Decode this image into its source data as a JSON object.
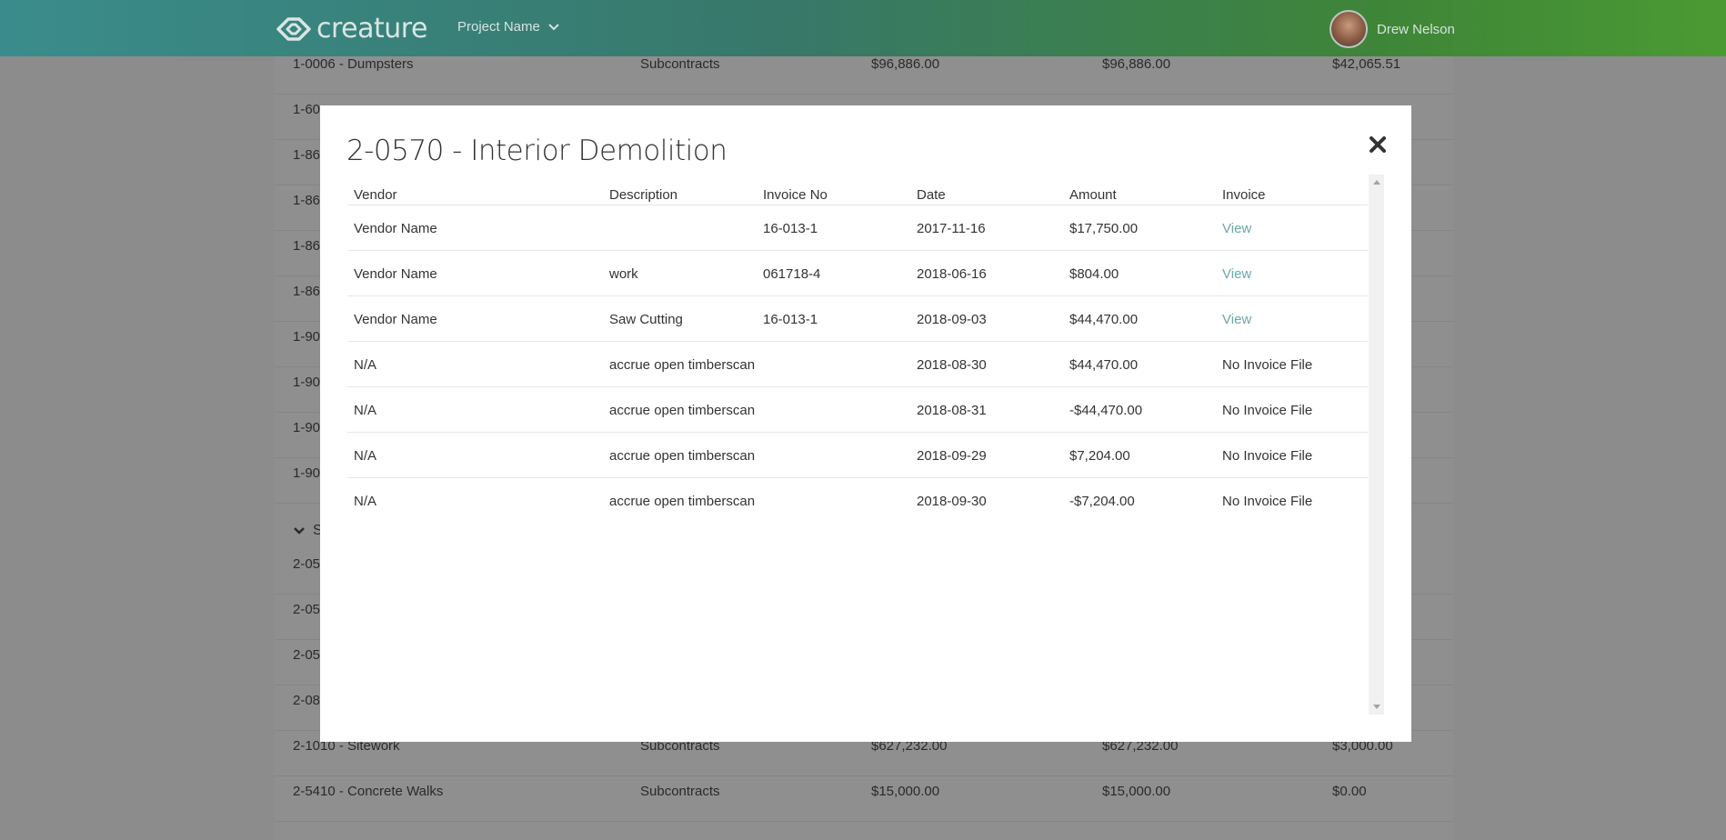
{
  "navbar": {
    "logo_text": "creature",
    "project_label": "Project Name",
    "user_name": "Drew Nelson"
  },
  "background_table": {
    "rows_top": [
      {
        "name": "1-0006 - Dumpsters",
        "type": "Subcontracts",
        "budget": "$96,886.00",
        "revised": "$96,886.00",
        "spent": "$42,065.51"
      },
      {
        "name": "1-60"
      },
      {
        "name": "1-86"
      },
      {
        "name": "1-86"
      },
      {
        "name": "1-86"
      },
      {
        "name": "1-86"
      },
      {
        "name": "1-90"
      },
      {
        "name": "1-90"
      },
      {
        "name": "1-90"
      },
      {
        "name": "1-90"
      }
    ],
    "group_label": "S",
    "rows_bottom": [
      {
        "name": "2-05"
      },
      {
        "name": "2-05"
      },
      {
        "name": "2-05"
      },
      {
        "name": "2-08"
      },
      {
        "name": "2-1010 - Sitework",
        "type": "Subcontracts",
        "budget": "$627,232.00",
        "revised": "$627,232.00",
        "spent": "$3,000.00"
      },
      {
        "name": "2-5410 - Concrete Walks",
        "type": "Subcontracts",
        "budget": "$15,000.00",
        "revised": "$15,000.00",
        "spent": "$0.00"
      }
    ]
  },
  "modal": {
    "title": "2-0570 - Interior Demolition",
    "columns": [
      "Vendor",
      "Description",
      "Invoice No",
      "Date",
      "Amount",
      "Invoice"
    ],
    "rows": [
      {
        "vendor": "Vendor Name",
        "description": "",
        "invoice_no": "16-013-1",
        "date": "2017-11-16",
        "amount": "$17,750.00",
        "invoice": "View",
        "has_link": true
      },
      {
        "vendor": "Vendor Name",
        "description": "work",
        "invoice_no": "061718-4",
        "date": "2018-06-16",
        "amount": "$804.00",
        "invoice": "View",
        "has_link": true
      },
      {
        "vendor": "Vendor Name",
        "description": "Saw Cutting",
        "invoice_no": "16-013-1",
        "date": "2018-09-03",
        "amount": "$44,470.00",
        "invoice": "View",
        "has_link": true
      },
      {
        "vendor": "N/A",
        "description": "accrue open timberscan",
        "invoice_no": "",
        "date": "2018-08-30",
        "amount": "$44,470.00",
        "invoice": "No Invoice File",
        "has_link": false
      },
      {
        "vendor": "N/A",
        "description": "accrue open timberscan",
        "invoice_no": "",
        "date": "2018-08-31",
        "amount": "-$44,470.00",
        "invoice": "No Invoice File",
        "has_link": false
      },
      {
        "vendor": "N/A",
        "description": "accrue open timberscan",
        "invoice_no": "",
        "date": "2018-09-29",
        "amount": "$7,204.00",
        "invoice": "No Invoice File",
        "has_link": false
      },
      {
        "vendor": "N/A",
        "description": "accrue open timberscan",
        "invoice_no": "",
        "date": "2018-09-30",
        "amount": "-$7,204.00",
        "invoice": "No Invoice File",
        "has_link": false
      }
    ]
  },
  "colors": {
    "nav_start": "#3a8c8c",
    "nav_end": "#4a9a33",
    "link": "#6aa7a7",
    "backdrop": "#8c8c8c"
  }
}
